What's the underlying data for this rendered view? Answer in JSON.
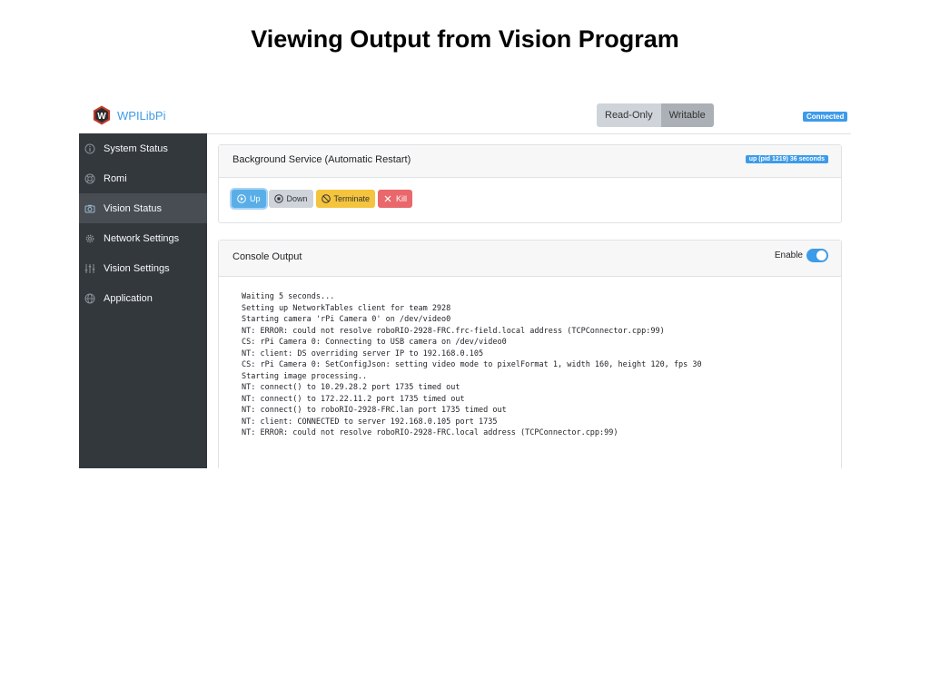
{
  "slide": {
    "title": "Viewing Output from Vision Program"
  },
  "navbar": {
    "brand_letter": "W",
    "brand_text": "WPILibPi",
    "mode_readonly": "Read-Only",
    "mode_writable": "Writable",
    "connection_status": "Connected"
  },
  "sidebar": {
    "items": [
      {
        "label": "System Status",
        "icon": "info-icon"
      },
      {
        "label": "Romi",
        "icon": "lifebuoy-icon"
      },
      {
        "label": "Vision Status",
        "icon": "camera-icon",
        "active": true
      },
      {
        "label": "Network Settings",
        "icon": "gear-icon"
      },
      {
        "label": "Vision Settings",
        "icon": "sliders-icon"
      },
      {
        "label": "Application",
        "icon": "globe-icon"
      }
    ]
  },
  "service": {
    "title": "Background Service (Automatic Restart)",
    "status": "up (pid 1219) 36 seconds",
    "buttons": {
      "up": "Up",
      "down": "Down",
      "terminate": "Terminate",
      "kill": "Kill"
    }
  },
  "console": {
    "title": "Console Output",
    "enable_label": "Enable",
    "enabled": true,
    "lines": [
      "Waiting 5 seconds...",
      "Setting up NetworkTables client for team 2928",
      "Starting camera 'rPi Camera 0' on /dev/video0",
      "NT: ERROR: could not resolve roboRIO-2928-FRC.frc-field.local address (TCPConnector.cpp:99)",
      "CS: rPi Camera 0: Connecting to USB camera on /dev/video0",
      "NT: client: DS overriding server IP to 192.168.0.105",
      "CS: rPi Camera 0: SetConfigJson: setting video mode to pixelFormat 1, width 160, height 120, fps 30",
      "Starting image processing..",
      "NT: connect() to 10.29.28.2 port 1735 timed out",
      "NT: connect() to 172.22.11.2 port 1735 timed out",
      "NT: connect() to roboRIO-2928-FRC.lan port 1735 timed out",
      "NT: client: CONNECTED to server 192.168.0.105 port 1735",
      "NT: ERROR: could not resolve roboRIO-2928-FRC.local address (TCPConnector.cpp:99)"
    ]
  },
  "colors": {
    "accent": "#3d9be9",
    "sidebar_bg": "#33383d",
    "sidebar_active": "#474d53",
    "terminate": "#f4c43e",
    "kill": "#e9686b"
  }
}
